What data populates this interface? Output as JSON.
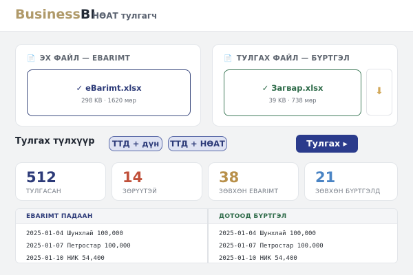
{
  "header": {
    "brand_a": "Business",
    "brand_b": "BI",
    "subtitle": "НӨАТ тулгагч"
  },
  "source_file": {
    "title_icon": "📄",
    "title": "ЭХ ФАЙЛ — EBARIMT",
    "file_name": "✓ eBarimt.xlsx",
    "file_meta": "298 KB · 1620 мөр",
    "border_color": "#3b4a7e",
    "text_color": "#2c3a78"
  },
  "compare_file": {
    "title_icon": "📄",
    "title": "ТУЛГАХ ФАЙЛ — БҮРТГЭЛ",
    "file_name": "✓ Загвар.xlsx",
    "file_meta": "39 KB · 738 мөр",
    "border_color": "#3f7a5a",
    "text_color": "#2e6b49",
    "download_icon": "⬇"
  },
  "match_keys": {
    "label": "Тулгах түлхүүр",
    "options": [
      "ТТД + дүн",
      "ТТД + НӨАТ"
    ]
  },
  "match_button": "Тулгах ▸",
  "stats": [
    {
      "value": "512",
      "label": "ТУЛГАСАН",
      "color": "#2c3a78"
    },
    {
      "value": "14",
      "label": "ЗӨРҮҮТЭЙ",
      "color": "#c0503a"
    },
    {
      "value": "38",
      "label": "ЗӨВХӨН EBARIMT",
      "color": "#b8904a"
    },
    {
      "value": "21",
      "label": "ЗӨВХӨН БҮРТГЭЛД",
      "color": "#4a84c4"
    }
  ],
  "ebarimt_list": {
    "header": "EBARIMT ПАДААН",
    "header_color": "#2c3a78",
    "rows": [
      "2025-01-04 Шунхлай 100,000",
      "2025-01-07 Петростар 100,000",
      "2025-01-10 НИК 54,400"
    ]
  },
  "internal_list": {
    "header": "ДОТООД БҮРТГЭЛ",
    "header_color": "#2e6b49",
    "rows": [
      "2025-01-04 Шунхлай 100,000",
      "2025-01-07 Петростар 100,000",
      "2025-01-10 НИК 54,400"
    ]
  }
}
